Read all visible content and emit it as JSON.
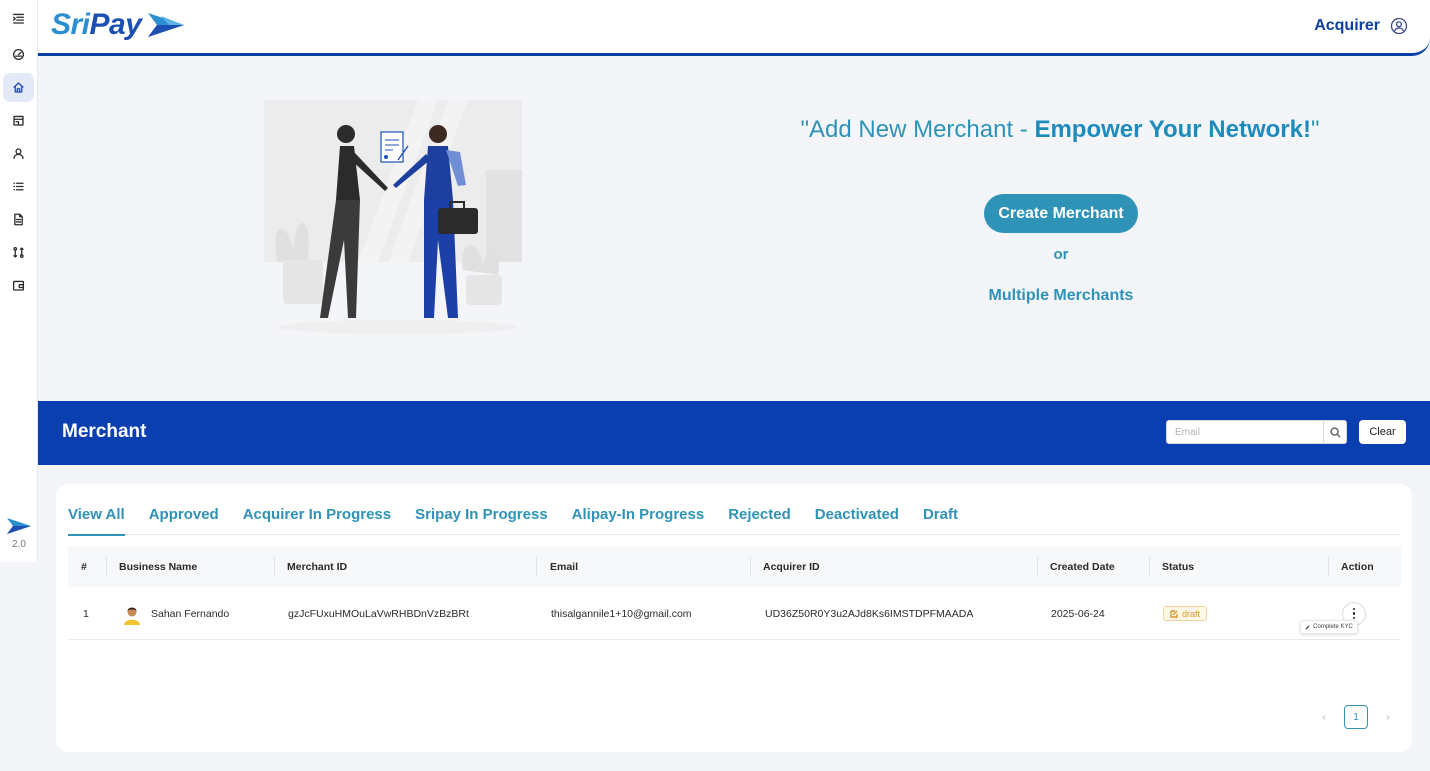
{
  "brand": {
    "part1": "Sri",
    "part2": "Pay"
  },
  "header": {
    "user_label": "Acquirer"
  },
  "sidebar": {
    "items": [
      {
        "name": "menu",
        "icon": "menu-icon"
      },
      {
        "name": "dashboard",
        "icon": "dashboard-icon"
      },
      {
        "name": "home",
        "icon": "home-icon",
        "active": true
      },
      {
        "name": "store",
        "icon": "store-icon"
      },
      {
        "name": "user",
        "icon": "user-icon"
      },
      {
        "name": "list",
        "icon": "list-icon"
      },
      {
        "name": "document",
        "icon": "document-icon"
      },
      {
        "name": "transfer",
        "icon": "transfer-icon"
      },
      {
        "name": "wallet",
        "icon": "wallet-icon"
      }
    ],
    "version": "2.0"
  },
  "hero": {
    "title_prefix": "\"Add New Merchant - ",
    "title_bold": "Empower Your Network!",
    "title_suffix": "\"",
    "create_button": "Create Merchant",
    "or": "or",
    "multiple_link": "Multiple Merchants"
  },
  "merchant": {
    "title": "Merchant",
    "search_placeholder": "Email",
    "clear_button": "Clear"
  },
  "tabs": [
    "View All",
    "Approved",
    "Acquirer In Progress",
    "Sripay In Progress",
    "Alipay-In Progress",
    "Rejected",
    "Deactivated",
    "Draft"
  ],
  "active_tab": "View All",
  "table": {
    "columns": [
      "#",
      "Business Name",
      "Merchant ID",
      "Email",
      "Acquirer ID",
      "Created Date",
      "Status",
      "Action"
    ],
    "rows": [
      {
        "index": "1",
        "business_name": "Sahan Fernando",
        "merchant_id": "gzJcFUxuHMOuLaVwRHBDnVzBzBRt",
        "email": "thisalgannile1+10@gmail.com",
        "acquirer_id": "UD36Z50R0Y3u2AJd8Ks6IMSTDPFMAADA",
        "created_date": "2025-06-24",
        "status": "draft"
      }
    ],
    "tooltip": "Complete KYC"
  },
  "pagination": {
    "current_page": "1",
    "prev": "‹",
    "next": "›"
  },
  "colors": {
    "primary": "#0a3fb0",
    "accent": "#2f93b8",
    "draft": "#d79a2b"
  }
}
